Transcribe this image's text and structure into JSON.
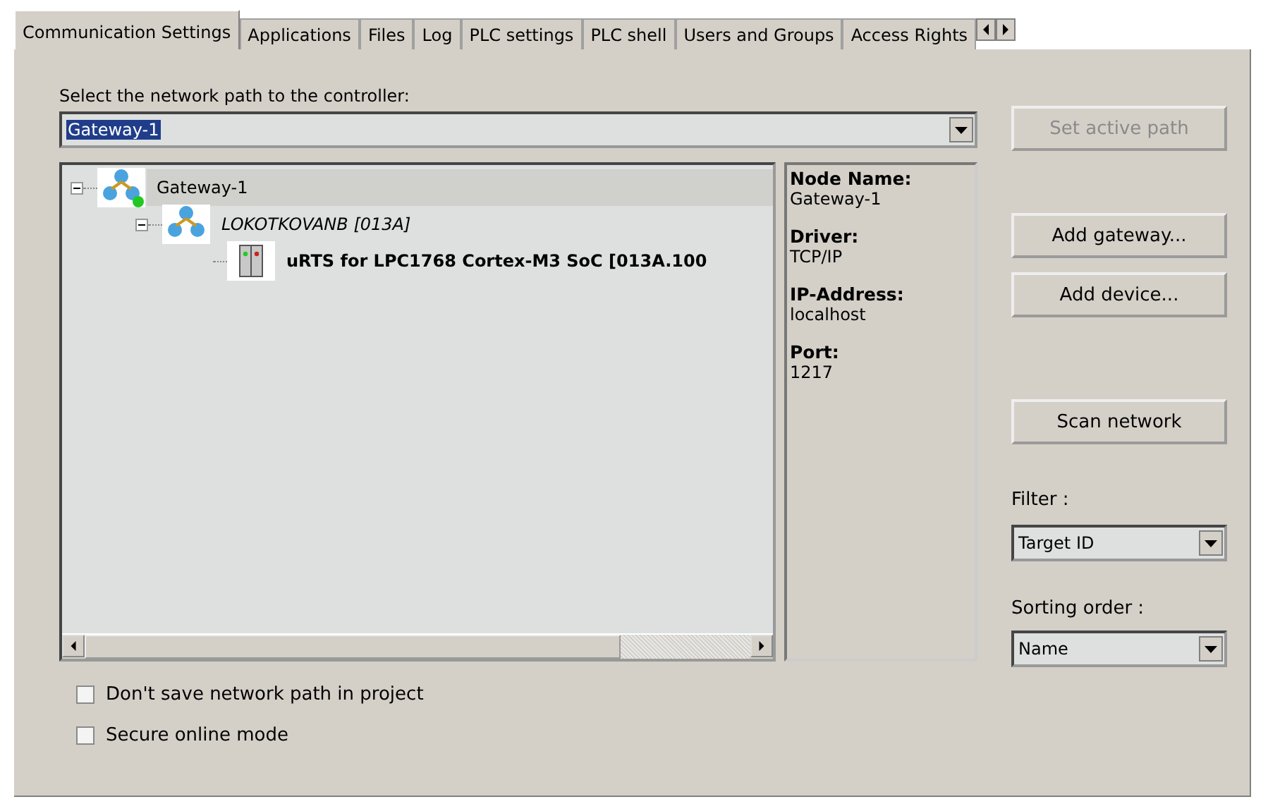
{
  "tabs": [
    {
      "label": "Communication Settings",
      "selected": true
    },
    {
      "label": "Applications",
      "selected": false
    },
    {
      "label": "Files",
      "selected": false
    },
    {
      "label": "Log",
      "selected": false
    },
    {
      "label": "PLC settings",
      "selected": false
    },
    {
      "label": "PLC shell",
      "selected": false
    },
    {
      "label": "Users and Groups",
      "selected": false
    },
    {
      "label": "Access Rights",
      "selected": false
    }
  ],
  "path_label": "Select the network path to the controller:",
  "path_combo": {
    "value": "Gateway-1"
  },
  "set_active_button": {
    "label": "Set active path",
    "disabled": true
  },
  "tree": [
    {
      "kind": "gateway",
      "label": "Gateway-1",
      "expanded": true,
      "selected": true,
      "connected": true,
      "children": [
        {
          "kind": "network",
          "label": "LOKOTKOVANB [013A]",
          "expanded": true,
          "selected": false,
          "connected": false,
          "children": [
            {
              "kind": "device",
              "label": "uRTS for LPC1768 Cortex-M3 SoC [013A.100",
              "selected": false,
              "connected": false
            }
          ]
        }
      ]
    }
  ],
  "info": [
    {
      "label": "Node Name:",
      "value": "Gateway-1"
    },
    {
      "label": "Driver:",
      "value": "TCP/IP"
    },
    {
      "label": "IP-Address:",
      "value": "localhost"
    },
    {
      "label": "Port:",
      "value": "1217"
    }
  ],
  "buttons": [
    {
      "label": "Add gateway..."
    },
    {
      "label": "Add device..."
    },
    {
      "label": "Scan network"
    }
  ],
  "filter": {
    "label": "Filter :",
    "value": "Target ID"
  },
  "sorting": {
    "label": "Sorting order :",
    "value": "Name"
  },
  "checkboxes": [
    {
      "label": "Don't save network path in project",
      "checked": false
    },
    {
      "label": "Secure online mode",
      "checked": false
    }
  ]
}
